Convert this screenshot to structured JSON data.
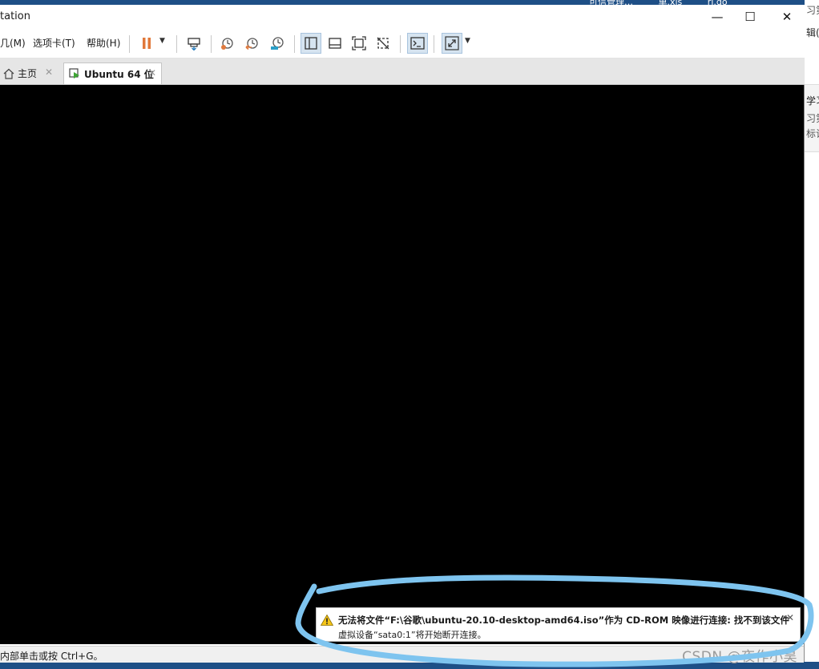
{
  "window": {
    "title": "tation",
    "controls": {
      "minimize": "—",
      "maximize": "☐",
      "close": "✕"
    }
  },
  "menubar": {
    "items": [
      "几(M)",
      "选项卡(T)",
      "帮助(H)"
    ]
  },
  "toolbar": {
    "icons": [
      "pause-icon",
      "send-ctrl-alt-del-icon",
      "snapshot-take-icon",
      "snapshot-revert-icon",
      "snapshot-manager-icon",
      "library-view-icon",
      "single-tab-view-icon",
      "fullscreen-icon",
      "unity-icon",
      "console-icon",
      "stretch-icon"
    ]
  },
  "tabs": [
    {
      "label": "主页",
      "icon": "home-icon",
      "close": "✕"
    },
    {
      "label": "Ubuntu 64 位",
      "icon": "vm-icon",
      "close": "✕"
    }
  ],
  "notification": {
    "line1": "无法将文件“F:\\谷歌\\ubuntu-20.10-desktop-amd64.iso”作为 CD-ROM 映像进行连接: 找不到该文件",
    "line2": "虚拟设备“sata0:1”将开始断开连接。",
    "close": "✕",
    "icon": "warning-icon"
  },
  "status": {
    "hint": "内部单击或按 Ctrl+G。",
    "watermark": "CSDN @夜作小昊"
  },
  "background": {
    "top_items": [
      "可信管理…",
      "单.xls",
      "ri.do"
    ],
    "right_texts": [
      "习第",
      "辑(I",
      "学习",
      "习第",
      "标记"
    ]
  },
  "colors": {
    "accent": "#1e4f86",
    "pause": "#e1783a",
    "snapshot": "#e07a3e",
    "highlight": "#7ec4ef"
  }
}
